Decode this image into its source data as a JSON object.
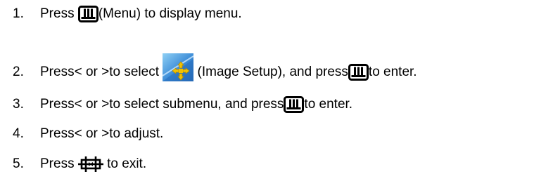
{
  "steps": [
    {
      "number": "1.",
      "parts": [
        "Press ",
        "(Menu) to display menu."
      ],
      "icons": [
        "menu-icon"
      ]
    },
    {
      "number": "2.",
      "parts": [
        "Press< or >to select ",
        " (Image Setup), and press",
        "to enter."
      ],
      "icons": [
        "image-setup-icon",
        "menu-icon"
      ]
    },
    {
      "number": "3.",
      "parts": [
        "Press< or >to select submenu, and press",
        "to enter."
      ],
      "icons": [
        "menu-icon"
      ]
    },
    {
      "number": "4.",
      "parts": [
        "Press< or >to adjust."
      ],
      "icons": []
    },
    {
      "number": "5.",
      "parts": [
        "Press ",
        " to exit."
      ],
      "icons": [
        "exit-icon"
      ]
    }
  ],
  "colors": {
    "text": "#000000",
    "image_setup_blue_dark": "#1f5fa8",
    "image_setup_blue_light": "#7cc3f0",
    "arrow_yellow": "#f2c200"
  }
}
